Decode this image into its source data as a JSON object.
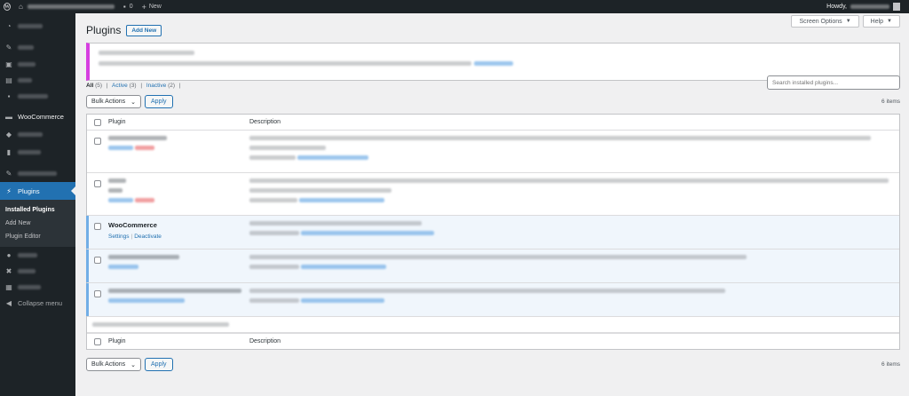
{
  "adminbar": {
    "comments_count": "0",
    "new_label": "New",
    "howdy": "Howdy,"
  },
  "sidebar": {
    "woocommerce": "WooCommerce",
    "plugins": "Plugins",
    "sub": [
      "Installed Plugins",
      "Add New",
      "Plugin Editor"
    ],
    "collapse": "Collapse menu"
  },
  "screen_meta": {
    "screen_options": "Screen Options",
    "help": "Help"
  },
  "page": {
    "title": "Plugins",
    "add_new": "Add New"
  },
  "filters": {
    "all": "All",
    "all_count": "(5)",
    "active": "Active",
    "active_count": "(3)",
    "inactive": "Inactive",
    "inactive_count": "(2)"
  },
  "search": {
    "placeholder": "Search installed plugins..."
  },
  "tablenav": {
    "bulk_actions": "Bulk Actions",
    "apply": "Apply",
    "count": "6 items"
  },
  "table": {
    "col_plugin": "Plugin",
    "col_description": "Description",
    "woocommerce_row": {
      "name": "WooCommerce",
      "settings": "Settings",
      "deactivate": "Deactivate"
    }
  },
  "colors": {
    "accent": "#2271b1",
    "sidebar_bg": "#1d2327",
    "active_border": "#72aee6",
    "notice_border": "#d63ee0"
  }
}
